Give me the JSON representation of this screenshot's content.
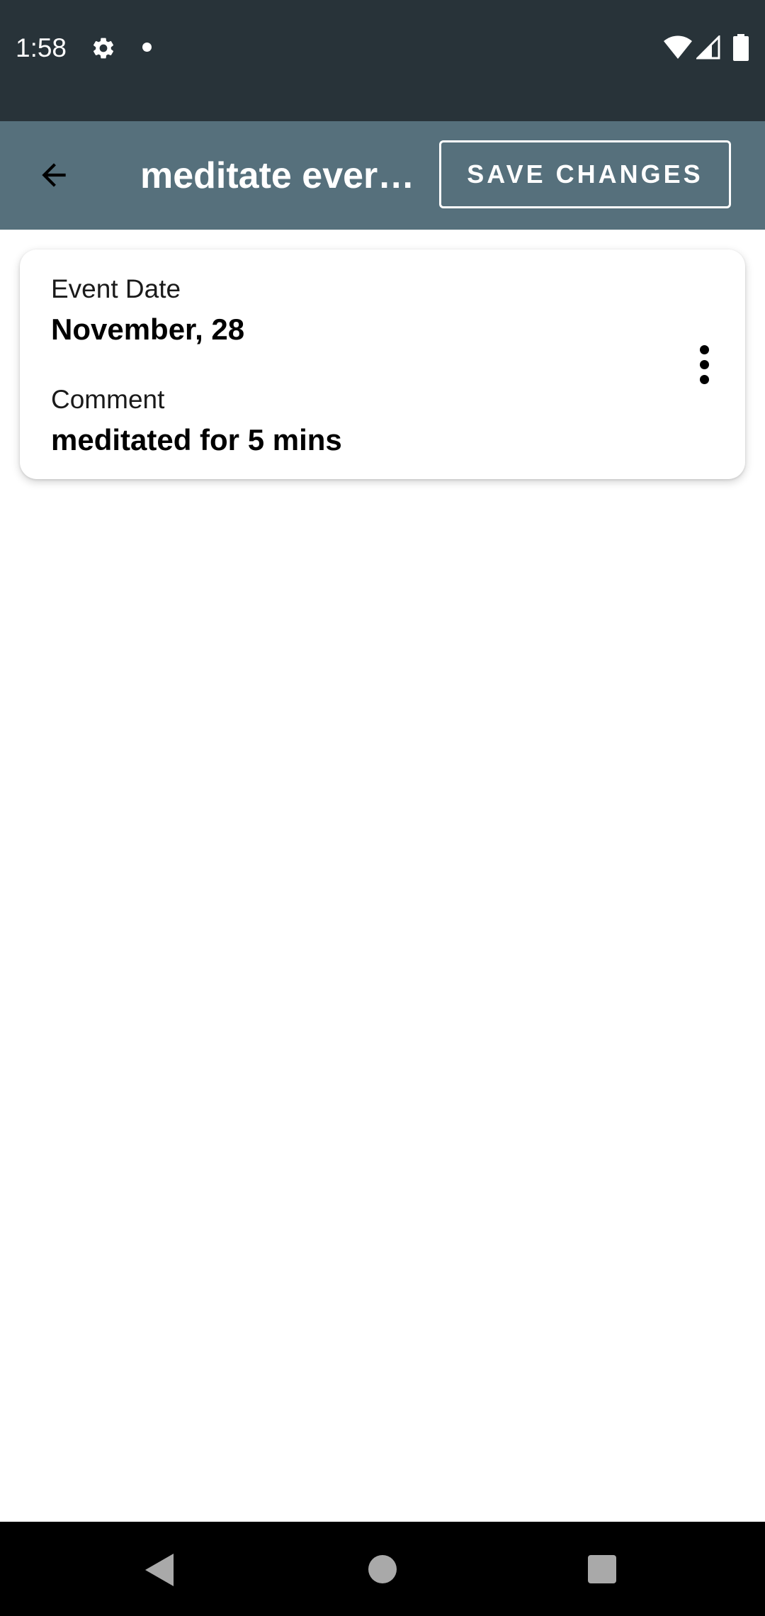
{
  "status_bar": {
    "time": "1:58",
    "icons": [
      "gear-icon",
      "notification-dot-icon",
      "wifi-icon",
      "signal-icon",
      "battery-icon"
    ]
  },
  "app_bar": {
    "title": "meditate ever…",
    "save_label": "SAVE CHANGES",
    "back_icon": "arrow-left-icon"
  },
  "event": {
    "date_label": "Event Date",
    "date_value": "November, 28",
    "comment_label": "Comment",
    "comment_value": "meditated for 5 mins",
    "menu_icon": "more-vert-icon"
  },
  "nav_bar": {
    "icons": [
      "back-triangle-icon",
      "home-circle-icon",
      "recents-square-icon"
    ]
  },
  "colors": {
    "status_bar_bg": "#283339",
    "app_bar_bg": "#56707c",
    "card_bg": "#ffffff",
    "nav_bar_bg": "#000000"
  }
}
